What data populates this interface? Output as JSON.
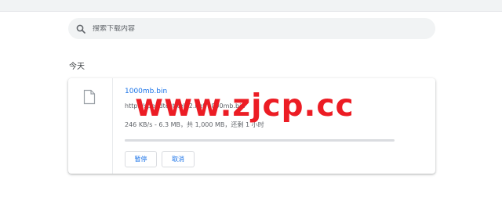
{
  "search": {
    "placeholder": "搜索下载内容"
  },
  "section": {
    "date_label": "今天"
  },
  "download": {
    "file_name": "1000mb.bin",
    "url": "http://speedtest.tele2.net/1000mb.bin",
    "status": "246 KB/s - 6.3 MB，共 1,000 MB，还剩 1 小时",
    "progress_fraction": 0.0063,
    "pause_label": "暂停",
    "cancel_label": "取消"
  },
  "watermark": {
    "text": "www.zjcp.cc"
  },
  "colors": {
    "accent": "#1a73e8",
    "watermark": "#ec1c24",
    "muted_text": "#5f6368"
  },
  "icons": {
    "search": "search-icon",
    "file": "file-icon"
  }
}
